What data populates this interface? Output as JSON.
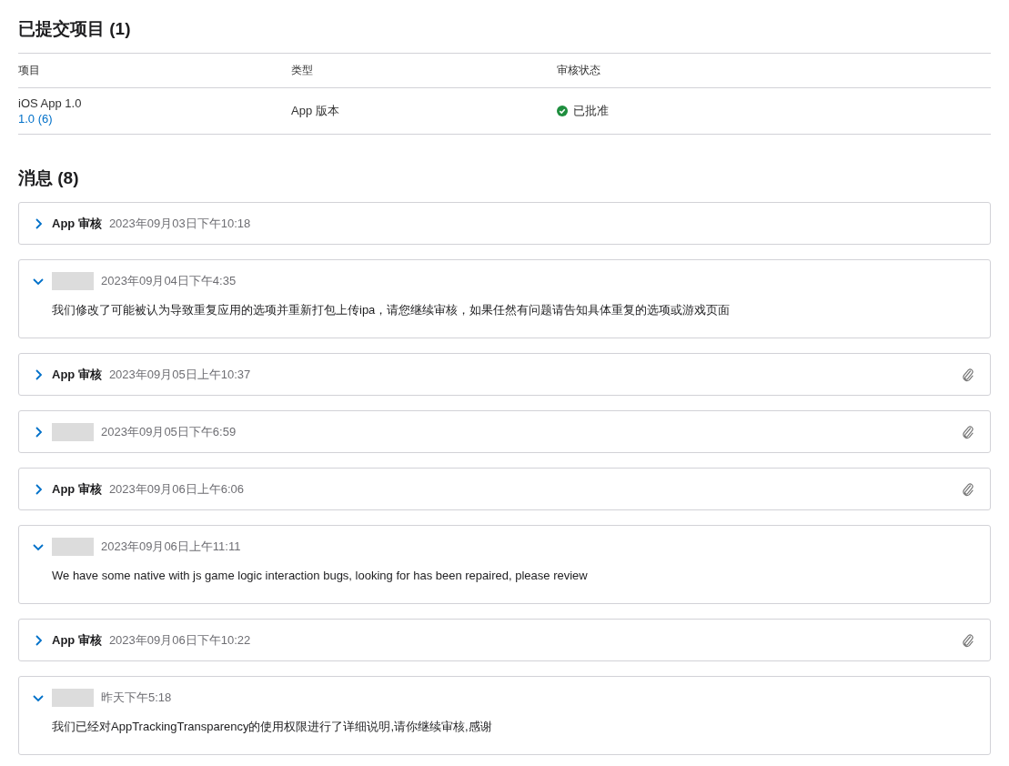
{
  "submitted": {
    "title": "已提交项目 (1)",
    "columns": [
      "项目",
      "类型",
      "审核状态"
    ],
    "rows": [
      {
        "item": "iOS App 1.0",
        "build": "1.0 (6)",
        "type": "App 版本",
        "status": "已批准",
        "kind": "approved"
      }
    ]
  },
  "messages": {
    "title": "消息 (8)",
    "items": [
      {
        "kind": "named",
        "sender": "App 审核",
        "date": "2023年09月03日下午10:18",
        "expanded": false,
        "attachment": false
      },
      {
        "kind": "redacted",
        "date": "2023年09月04日下午4:35",
        "expanded": true,
        "attachment": false,
        "body": "我们修改了可能被认为导致重复应用的选项并重新打包上传ipa，请您继续审核，如果任然有问题请告知具体重复的选项或游戏页面"
      },
      {
        "kind": "named",
        "sender": "App 审核",
        "date": "2023年09月05日上午10:37",
        "expanded": false,
        "attachment": true
      },
      {
        "kind": "redacted",
        "date": "2023年09月05日下午6:59",
        "expanded": false,
        "attachment": true
      },
      {
        "kind": "named",
        "sender": "App 审核",
        "date": "2023年09月06日上午6:06",
        "expanded": false,
        "attachment": true
      },
      {
        "kind": "redacted",
        "date": "2023年09月06日上午11:11",
        "expanded": true,
        "attachment": false,
        "body": "We have some native with js game logic interaction bugs, looking for has been repaired, please review"
      },
      {
        "kind": "named",
        "sender": "App 审核",
        "date": "2023年09月06日下午10:22",
        "expanded": false,
        "attachment": true
      },
      {
        "kind": "redacted",
        "date": "昨天下午5:18",
        "expanded": true,
        "attachment": false,
        "body": "我们已经对AppTrackingTransparency的使用权限进行了详细说明,请你继续审核,感谢"
      }
    ]
  }
}
